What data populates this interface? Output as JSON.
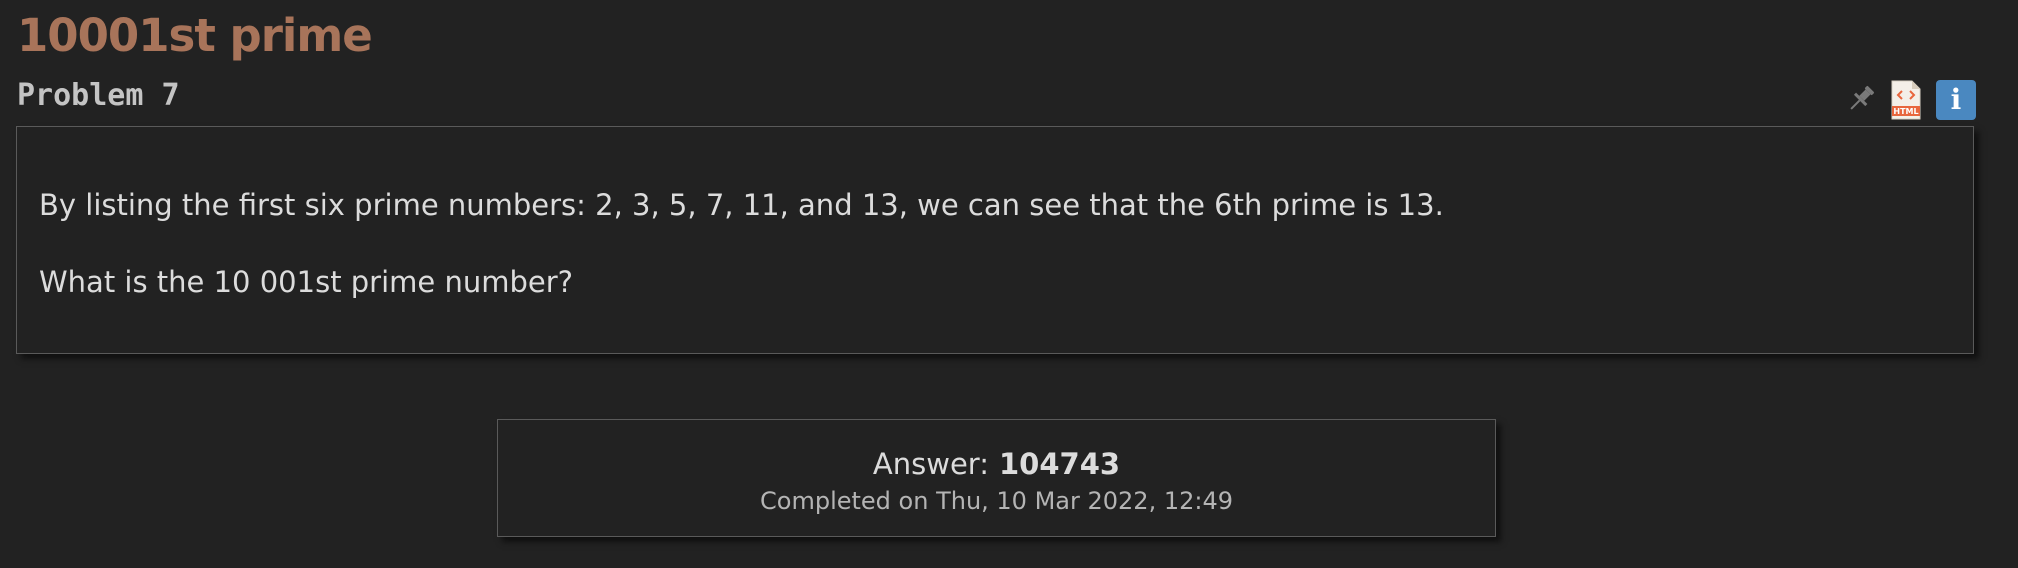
{
  "problem": {
    "title": "10001st prime",
    "label": "Problem 7",
    "paragraphs": [
      "By listing the first six prime numbers: 2, 3, 5, 7, 11, and 13, we can see that the 6th prime is 13.",
      "What is the 10 001st prime number?"
    ]
  },
  "toolbar": {
    "icons": [
      "pin-icon",
      "html-file-icon",
      "info-icon"
    ],
    "html_badge": "HTML",
    "info_glyph": "i"
  },
  "answer": {
    "label": "Answer:",
    "value": "104743",
    "completed": "Completed on Thu, 10 Mar 2022, 12:49"
  },
  "colors": {
    "background": "#222222",
    "title": "#a8745a",
    "text": "#dcdcdc",
    "border": "#5a5a5a",
    "info_icon_bg": "#4a88c0",
    "html_icon": "#e8663d"
  }
}
